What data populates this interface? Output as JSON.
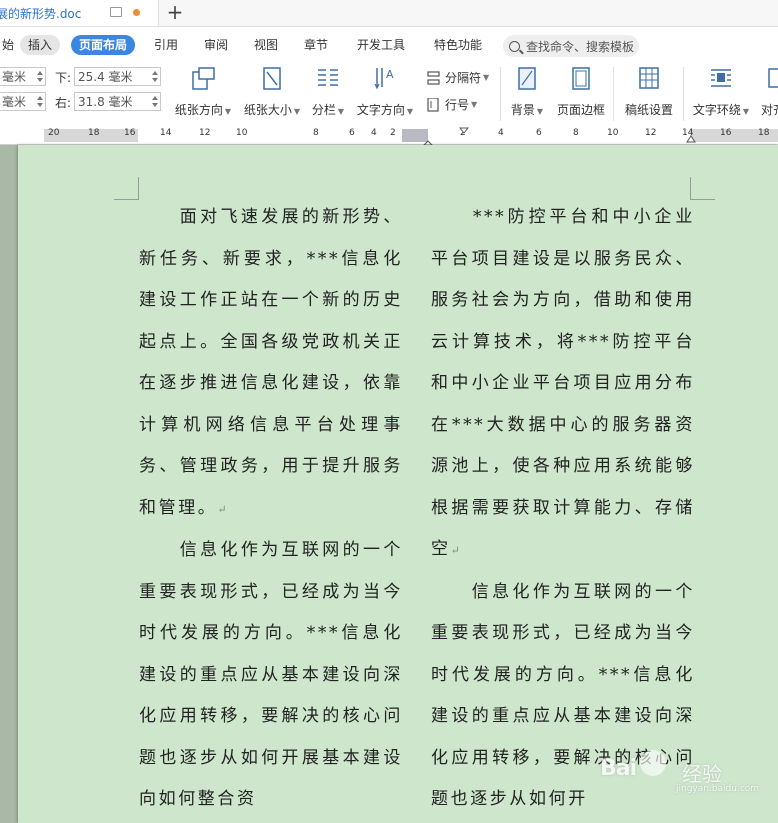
{
  "titlebar": {
    "doc_title": "展的新形势.doc"
  },
  "menu": {
    "items": [
      {
        "label": "始",
        "style": "plain"
      },
      {
        "label": "插入",
        "style": "pill"
      },
      {
        "label": "页面布局",
        "style": "active"
      },
      {
        "label": "引用",
        "style": "plain"
      },
      {
        "label": "审阅",
        "style": "plain"
      },
      {
        "label": "视图",
        "style": "plain"
      },
      {
        "label": "章节",
        "style": "plain"
      },
      {
        "label": "开发工具",
        "style": "plain"
      },
      {
        "label": "特色功能",
        "style": "plain"
      }
    ],
    "search_placeholder": "查找命令、搜索模板"
  },
  "ribbon": {
    "margins": {
      "top_left_value": "毫米",
      "bottom_left_value": "毫米",
      "bottom_label": "下:",
      "bottom_value": "25.4 毫米",
      "right_label": "右:",
      "right_value": "31.8 毫米"
    },
    "tools": {
      "orientation": "纸张方向",
      "size": "纸张大小",
      "columns": "分栏",
      "text_direction": "文字方向",
      "separator": "分隔符",
      "line_number": "行号",
      "background": "背景",
      "page_border": "页面边框",
      "draft_settings": "稿纸设置",
      "text_wrap": "文字环绕",
      "align": "对齐"
    }
  },
  "ruler": {
    "numbers": [
      "20",
      "18",
      "16",
      "14",
      "12",
      "10",
      "8",
      "6",
      "4",
      "2",
      "2",
      "4",
      "6",
      "8",
      "10",
      "12",
      "14",
      "16",
      "18"
    ]
  },
  "document": {
    "left_column": [
      "　　面对飞速发展的新形势、新任务、新要求，***信息化建设工作正站在一个新的历史起点上。全国各级党政机关正在逐步推进信息化建设，依靠计算机网络信息平台处理事务、管理政务，用于提升服务和管理。",
      "　　信息化作为互联网的一个重要表现形式，已经成为当今时代发展的方向。***信息化建设的重点应从基本建设向深化应用转移，要解决的核心问题也逐步从如何开展基本建设向如何整合资"
    ],
    "right_column": [
      "　　***防控平台和中小企业平台项目建设是以服务民众、服务社会为方向，借助和使用云计算技术，将***防控平台和中小企业平台项目应用分布在***大数据中心的服务器资源池上，使各种应用系统能够根据需要获取计算能力、存储空",
      "　　信息化作为互联网的一个重要表现形式，已经成为当今时代发展的方向。***信息化建设的重点应从基本建设向深化应用转移，要解决的核心问题也逐步从如何开"
    ],
    "paragraph_mark": "↵"
  },
  "watermark": {
    "brand": "Bai",
    "brand_suffix": "经验",
    "url": "jingyan.baidu.com"
  }
}
